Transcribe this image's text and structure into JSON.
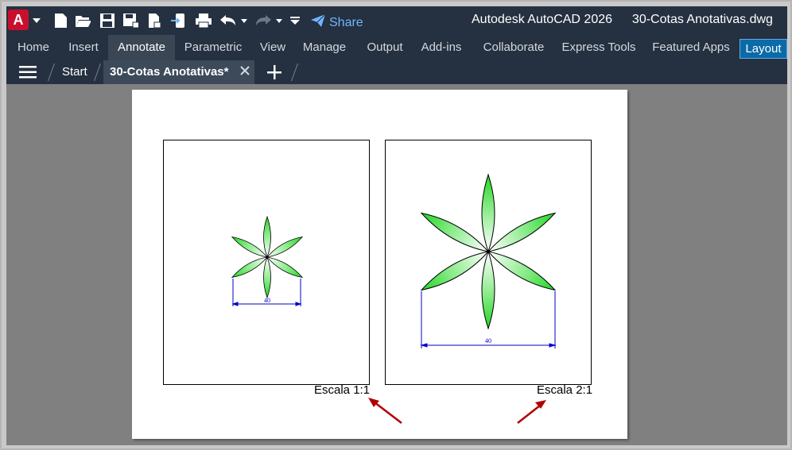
{
  "app": {
    "logo_letter": "A",
    "share_label": "Share",
    "title": "Autodesk AutoCAD 2026",
    "filename": "30-Cotas Anotativas.dwg"
  },
  "ribbon": {
    "tabs": [
      "Home",
      "Insert",
      "Annotate",
      "Parametric",
      "View",
      "Manage",
      "Output",
      "Add-ins",
      "Collaborate",
      "Express Tools",
      "Featured Apps",
      "Layout"
    ],
    "active_tab": "Annotate"
  },
  "file_tabs": {
    "start": "Start",
    "active": "30-Cotas Anotativas*"
  },
  "viewports": [
    {
      "scale_label": "Escala 1:1",
      "dimension": "40"
    },
    {
      "scale_label": "Escala 2:1",
      "dimension": "40"
    }
  ],
  "colors": {
    "petal_green": "#1fd51f",
    "dimension_blue": "#0000cc",
    "arrow_red": "#b00000",
    "accent_blue": "#0b6aa8"
  }
}
